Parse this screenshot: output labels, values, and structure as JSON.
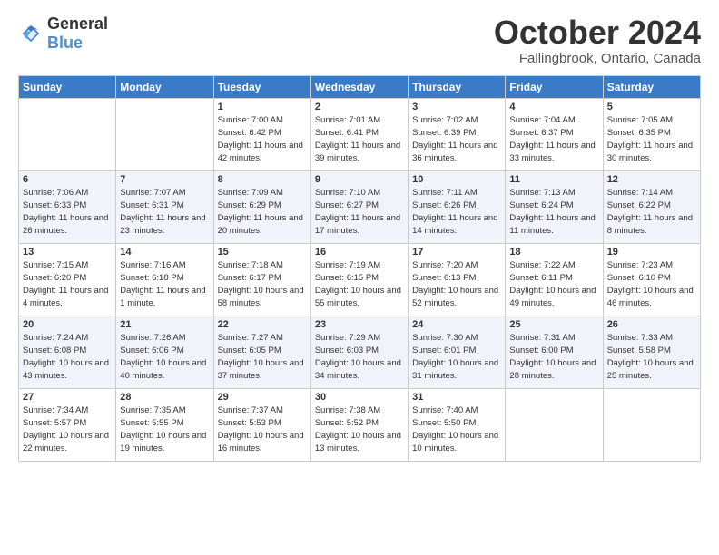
{
  "logo": {
    "general": "General",
    "blue": "Blue"
  },
  "title": "October 2024",
  "subtitle": "Fallingbrook, Ontario, Canada",
  "headers": [
    "Sunday",
    "Monday",
    "Tuesday",
    "Wednesday",
    "Thursday",
    "Friday",
    "Saturday"
  ],
  "weeks": [
    [
      {
        "day": "",
        "info": ""
      },
      {
        "day": "",
        "info": ""
      },
      {
        "day": "1",
        "info": "Sunrise: 7:00 AM\nSunset: 6:42 PM\nDaylight: 11 hours and 42 minutes."
      },
      {
        "day": "2",
        "info": "Sunrise: 7:01 AM\nSunset: 6:41 PM\nDaylight: 11 hours and 39 minutes."
      },
      {
        "day": "3",
        "info": "Sunrise: 7:02 AM\nSunset: 6:39 PM\nDaylight: 11 hours and 36 minutes."
      },
      {
        "day": "4",
        "info": "Sunrise: 7:04 AM\nSunset: 6:37 PM\nDaylight: 11 hours and 33 minutes."
      },
      {
        "day": "5",
        "info": "Sunrise: 7:05 AM\nSunset: 6:35 PM\nDaylight: 11 hours and 30 minutes."
      }
    ],
    [
      {
        "day": "6",
        "info": "Sunrise: 7:06 AM\nSunset: 6:33 PM\nDaylight: 11 hours and 26 minutes."
      },
      {
        "day": "7",
        "info": "Sunrise: 7:07 AM\nSunset: 6:31 PM\nDaylight: 11 hours and 23 minutes."
      },
      {
        "day": "8",
        "info": "Sunrise: 7:09 AM\nSunset: 6:29 PM\nDaylight: 11 hours and 20 minutes."
      },
      {
        "day": "9",
        "info": "Sunrise: 7:10 AM\nSunset: 6:27 PM\nDaylight: 11 hours and 17 minutes."
      },
      {
        "day": "10",
        "info": "Sunrise: 7:11 AM\nSunset: 6:26 PM\nDaylight: 11 hours and 14 minutes."
      },
      {
        "day": "11",
        "info": "Sunrise: 7:13 AM\nSunset: 6:24 PM\nDaylight: 11 hours and 11 minutes."
      },
      {
        "day": "12",
        "info": "Sunrise: 7:14 AM\nSunset: 6:22 PM\nDaylight: 11 hours and 8 minutes."
      }
    ],
    [
      {
        "day": "13",
        "info": "Sunrise: 7:15 AM\nSunset: 6:20 PM\nDaylight: 11 hours and 4 minutes."
      },
      {
        "day": "14",
        "info": "Sunrise: 7:16 AM\nSunset: 6:18 PM\nDaylight: 11 hours and 1 minute."
      },
      {
        "day": "15",
        "info": "Sunrise: 7:18 AM\nSunset: 6:17 PM\nDaylight: 10 hours and 58 minutes."
      },
      {
        "day": "16",
        "info": "Sunrise: 7:19 AM\nSunset: 6:15 PM\nDaylight: 10 hours and 55 minutes."
      },
      {
        "day": "17",
        "info": "Sunrise: 7:20 AM\nSunset: 6:13 PM\nDaylight: 10 hours and 52 minutes."
      },
      {
        "day": "18",
        "info": "Sunrise: 7:22 AM\nSunset: 6:11 PM\nDaylight: 10 hours and 49 minutes."
      },
      {
        "day": "19",
        "info": "Sunrise: 7:23 AM\nSunset: 6:10 PM\nDaylight: 10 hours and 46 minutes."
      }
    ],
    [
      {
        "day": "20",
        "info": "Sunrise: 7:24 AM\nSunset: 6:08 PM\nDaylight: 10 hours and 43 minutes."
      },
      {
        "day": "21",
        "info": "Sunrise: 7:26 AM\nSunset: 6:06 PM\nDaylight: 10 hours and 40 minutes."
      },
      {
        "day": "22",
        "info": "Sunrise: 7:27 AM\nSunset: 6:05 PM\nDaylight: 10 hours and 37 minutes."
      },
      {
        "day": "23",
        "info": "Sunrise: 7:29 AM\nSunset: 6:03 PM\nDaylight: 10 hours and 34 minutes."
      },
      {
        "day": "24",
        "info": "Sunrise: 7:30 AM\nSunset: 6:01 PM\nDaylight: 10 hours and 31 minutes."
      },
      {
        "day": "25",
        "info": "Sunrise: 7:31 AM\nSunset: 6:00 PM\nDaylight: 10 hours and 28 minutes."
      },
      {
        "day": "26",
        "info": "Sunrise: 7:33 AM\nSunset: 5:58 PM\nDaylight: 10 hours and 25 minutes."
      }
    ],
    [
      {
        "day": "27",
        "info": "Sunrise: 7:34 AM\nSunset: 5:57 PM\nDaylight: 10 hours and 22 minutes."
      },
      {
        "day": "28",
        "info": "Sunrise: 7:35 AM\nSunset: 5:55 PM\nDaylight: 10 hours and 19 minutes."
      },
      {
        "day": "29",
        "info": "Sunrise: 7:37 AM\nSunset: 5:53 PM\nDaylight: 10 hours and 16 minutes."
      },
      {
        "day": "30",
        "info": "Sunrise: 7:38 AM\nSunset: 5:52 PM\nDaylight: 10 hours and 13 minutes."
      },
      {
        "day": "31",
        "info": "Sunrise: 7:40 AM\nSunset: 5:50 PM\nDaylight: 10 hours and 10 minutes."
      },
      {
        "day": "",
        "info": ""
      },
      {
        "day": "",
        "info": ""
      }
    ]
  ]
}
